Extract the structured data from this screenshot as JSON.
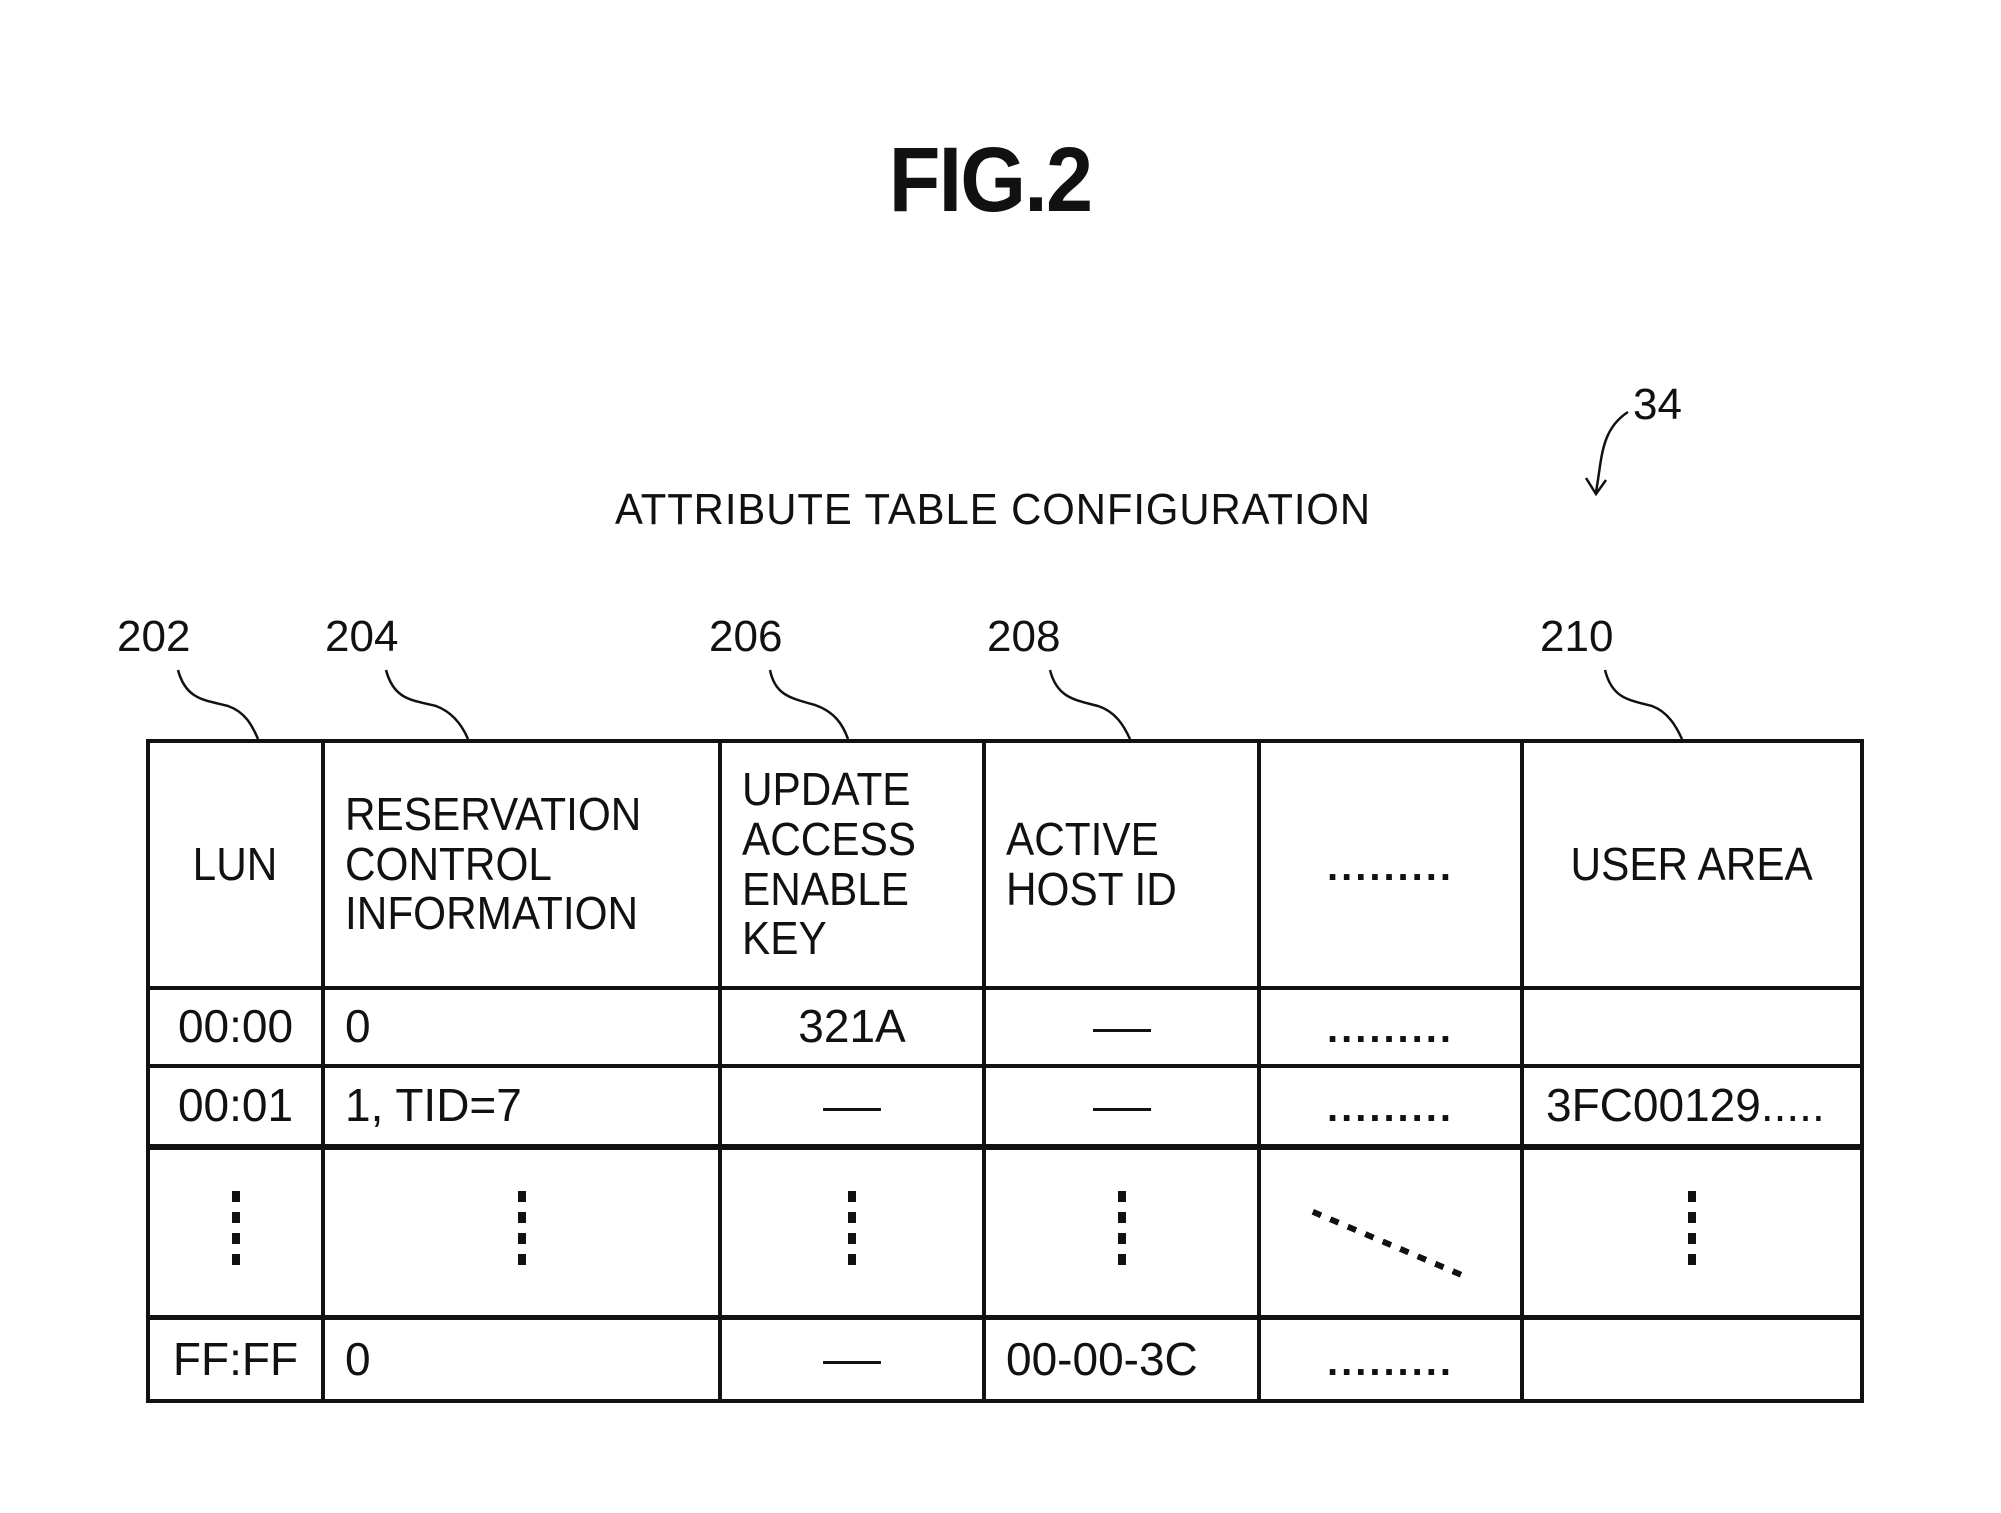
{
  "figure": {
    "title": "FIG.2",
    "reference_numeral": "34",
    "caption": "ATTRIBUTE TABLE CONFIGURATION"
  },
  "column_refs": [
    "202",
    "204",
    "206",
    "208",
    "210"
  ],
  "table": {
    "headers": [
      [
        "LUN"
      ],
      [
        "RESERVATION",
        "CONTROL",
        "INFORMATION"
      ],
      [
        "UPDATE",
        "ACCESS",
        "ENABLE",
        "KEY"
      ],
      [
        "ACTIVE",
        "HOST ID"
      ],
      [
        "........."
      ],
      [
        "USER AREA"
      ]
    ],
    "rows": [
      {
        "lun": "00:00",
        "reservation": "0",
        "update_key": "321A",
        "host_id": "—",
        "more": ".........",
        "user_area": ""
      },
      {
        "lun": "00:01",
        "reservation": "1, TID=7",
        "update_key": "—",
        "host_id": "—",
        "more": ".........",
        "user_area": "3FC00129....."
      },
      {
        "lun": "⋮",
        "reservation": "⋮",
        "update_key": "⋮",
        "host_id": "⋮",
        "more": "⋱",
        "user_area": "⋮"
      },
      {
        "lun": "FF:FF",
        "reservation": "0",
        "update_key": "—",
        "host_id": "00-00-3C",
        "more": ".........",
        "user_area": ""
      }
    ]
  }
}
